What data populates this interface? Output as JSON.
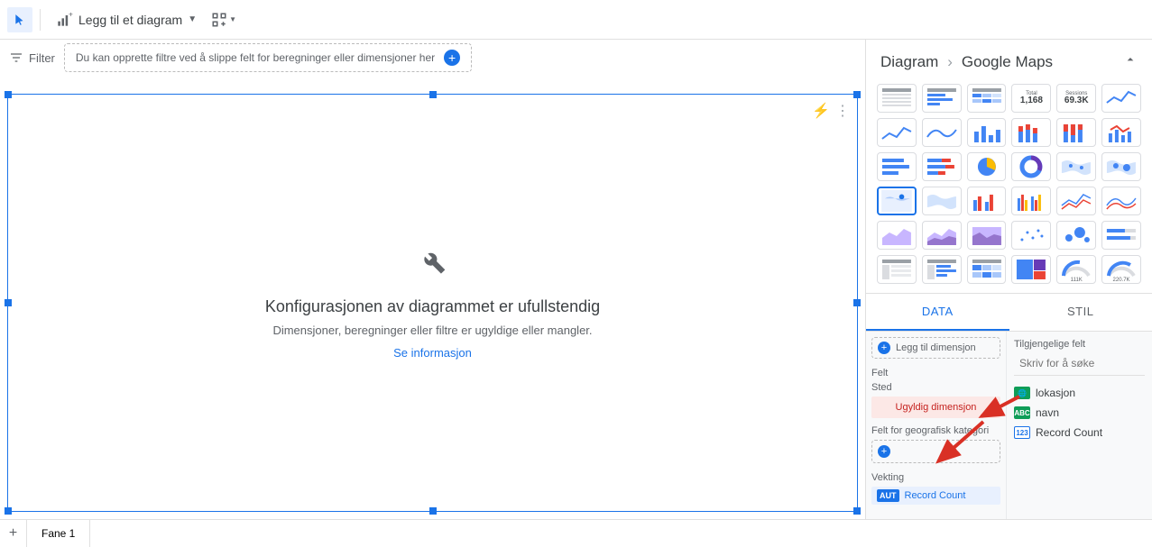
{
  "toolbar": {
    "add_chart_label": "Legg til et diagram"
  },
  "filter": {
    "label": "Filter",
    "placeholder": "Du kan opprette filtre ved å slippe felt for beregninger eller dimensjoner her"
  },
  "canvas": {
    "error_title": "Konfigurasjonen av diagrammet er ufullstendig",
    "error_subtitle": "Dimensjoner, beregninger eller filtre er ugyldige eller mangler.",
    "error_link": "Se informasjon"
  },
  "panel": {
    "breadcrumb_root": "Diagram",
    "breadcrumb_leaf": "Google Maps",
    "tab_data": "DATA",
    "tab_style": "STIL",
    "scorecard1_label": "Total",
    "scorecard1_value": "1,168",
    "scorecard2_label": "Sessions",
    "scorecard2_value": "69.3K",
    "gauge1_value": "111K",
    "gauge2_value": "220.7K"
  },
  "data_config": {
    "add_dimension": "Legg til dimensjon",
    "felt_label": "Felt",
    "sted_label": "Sted",
    "invalid_dimension": "Ugyldig dimensjon",
    "geo_field_label": "Felt for geografisk kategori",
    "vekting_label": "Vekting",
    "metric_badge": "AUT",
    "metric_name": "Record Count"
  },
  "available_fields": {
    "title": "Tilgjengelige felt",
    "search_placeholder": "Skriv for å søke",
    "fields": [
      {
        "name": "lokasjon",
        "type": "geo"
      },
      {
        "name": "navn",
        "type": "text"
      },
      {
        "name": "Record Count",
        "type": "num"
      }
    ]
  },
  "pages": {
    "tab1": "Fane 1"
  }
}
